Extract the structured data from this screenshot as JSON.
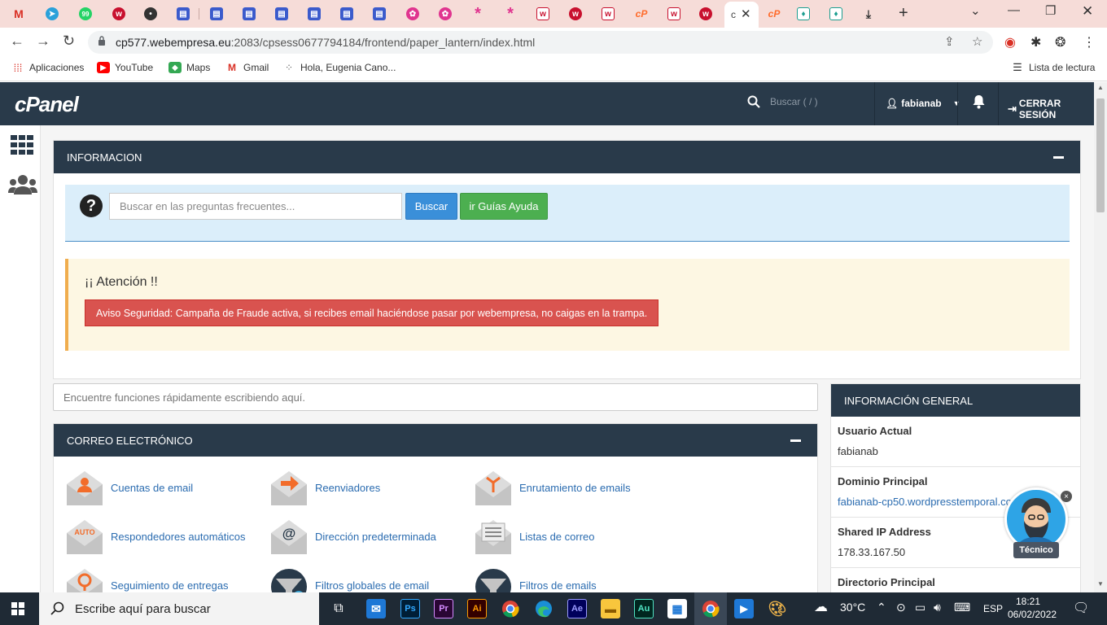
{
  "browser": {
    "active_tab_title": "c",
    "url_host": "cp577.webempresa.eu",
    "url_rest": ":2083/cpsess0677794184/frontend/paper_lantern/index.html",
    "bookmarks": [
      "Aplicaciones",
      "YouTube",
      "Maps",
      "Gmail",
      "Hola, Eugenia Cano..."
    ],
    "reading_list": "Lista de lectura"
  },
  "cpanel": {
    "logo": "cPanel",
    "search_placeholder": "Buscar ( / )",
    "user": "fabianab",
    "logout": "CERRAR SESIÓN",
    "info_panel": {
      "title": "INFORMACION",
      "faq_placeholder": "Buscar en las preguntas frecuentes...",
      "search_button": "Buscar",
      "guides_button": "ir Guías Ayuda",
      "alert_title": "¡¡ Atención !!",
      "alert_message": "Aviso Seguridad: Campaña de Fraude activa, si recibes email haciéndose pasar por webempresa, no caigas en la trampa."
    },
    "quick_search_placeholder": "Encuentre funciones rápidamente escribiendo aquí.",
    "email_panel": {
      "title": "CORREO ELECTRÓNICO",
      "items": [
        {
          "label": "Cuentas de email"
        },
        {
          "label": "Reenviadores"
        },
        {
          "label": "Enrutamiento de emails"
        },
        {
          "label": "Respondedores automáticos",
          "badge": "AUTO"
        },
        {
          "label": "Dirección predeterminada"
        },
        {
          "label": "Listas de correo"
        },
        {
          "label": "Seguimiento de entregas"
        },
        {
          "label": "Filtros globales de email"
        },
        {
          "label": "Filtros de emails"
        }
      ]
    },
    "general_info": {
      "title": "INFORMACIÓN GENERAL",
      "rows": [
        {
          "key": "Usuario Actual",
          "value": "fabianab"
        },
        {
          "key": "Dominio Principal",
          "value": "fabianab-cp50.wordpresstemporal.com"
        },
        {
          "key": "Shared IP Address",
          "value": "178.33.167.50"
        },
        {
          "key": "Directorio Principal",
          "value": ""
        }
      ]
    },
    "chat_bot_label": "Técnico"
  },
  "taskbar": {
    "search_placeholder": "Escribe aquí para buscar",
    "temperature": "30°C",
    "language": "ESP",
    "time": "18:21",
    "date": "06/02/2022",
    "apps": [
      "Ps",
      "Pr",
      "Ai",
      "Ae",
      "Au"
    ]
  }
}
